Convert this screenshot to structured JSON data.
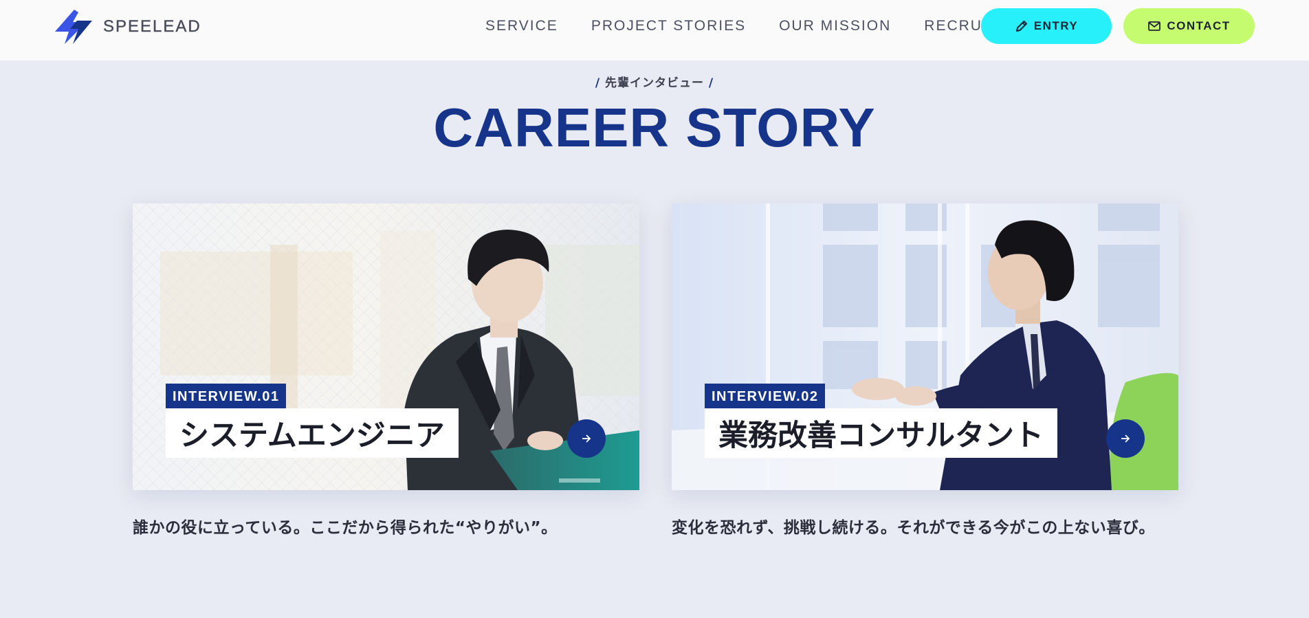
{
  "header": {
    "logo_text": "SPEELEAD",
    "nav": [
      {
        "label": "SERVICE"
      },
      {
        "label": "PROJECT STORIES"
      },
      {
        "label": "OUR MISSION"
      },
      {
        "label": "RECRUIT"
      }
    ],
    "entry_label": "ENTRY",
    "contact_label": "CONTACT",
    "entry_icon": "pencil-icon",
    "contact_icon": "mail-icon"
  },
  "section": {
    "eyebrow_open": "/",
    "eyebrow": "先輩インタビュー",
    "eyebrow_close": "/",
    "title": "CAREER STORY"
  },
  "cards": [
    {
      "badge": "INTERVIEW.01",
      "title": "システムエンジニア",
      "caption": "誰かの役に立っている。ここだから得られた“やりがい”。",
      "photo_alt": "young man in suit looking at laptop",
      "arrow_icon": "arrow-right-icon"
    },
    {
      "badge": "INTERVIEW.02",
      "title": "業務改善コンサルタント",
      "caption": "変化を恐れず、挑戦し続ける。それができる今がこの上ない喜び。",
      "photo_alt": "man in suit gesturing in office meeting",
      "arrow_icon": "arrow-right-icon"
    }
  ],
  "colors": {
    "background": "#e8ebf3",
    "header_bg": "#fafafb",
    "brand_navy": "#16348a",
    "entry_cyan": "#27f0fb",
    "contact_lime": "#c5fc6f"
  }
}
